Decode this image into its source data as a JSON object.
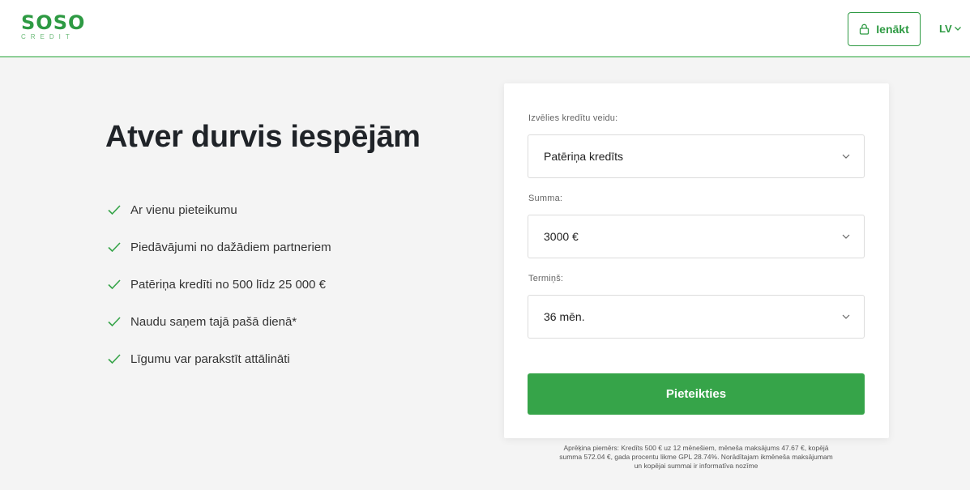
{
  "header": {
    "logo": {
      "main": "SOSO",
      "sub": "CREDIT"
    },
    "login_label": "Ienākt",
    "language": "LV"
  },
  "hero": {
    "title": "Atver durvis iespējām",
    "features": [
      "Ar vienu pieteikumu",
      "Piedāvājumi no dažādiem partneriem",
      "Patēriņa kredīti no 500 līdz 25 000 €",
      "Naudu saņem tajā pašā dienā*",
      "Līgumu var parakstīt attālināti"
    ]
  },
  "form": {
    "credit_type": {
      "label": "Izvēlies kredītu veidu:",
      "value": "Patēriņa kredīts"
    },
    "amount": {
      "label": "Summa:",
      "value": "3000 €"
    },
    "term": {
      "label": "Termiņš:",
      "value": "36 mēn."
    },
    "submit_label": "Pieteikties"
  },
  "footnote": {
    "line1": "Aprēķina piemērs: Kredīts 500 € uz 12 mēnešiem, mēneša maksājums 47.67 €, kopējā",
    "line2": "summa 572.04 €, gada procentu likme GPL 28.74%. Norādītajam ikmēneša maksājumam",
    "line3": "un kopējai summai ir informatīva nozīme"
  },
  "colors": {
    "brand_green": "#36a449",
    "text_dark": "#1f2328",
    "background": "#f4f4f4"
  }
}
